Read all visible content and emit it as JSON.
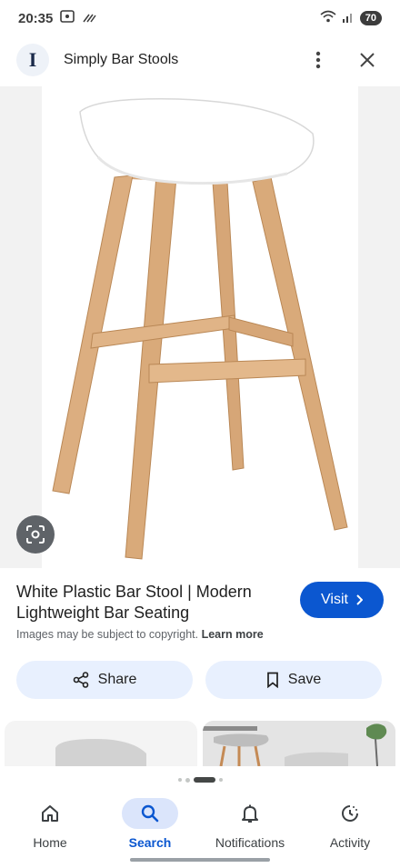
{
  "status_bar": {
    "time": "20:35",
    "battery": "70"
  },
  "header": {
    "logo_letter": "I",
    "site_name": "Simply Bar Stools"
  },
  "product": {
    "title": "White Plastic Bar Stool | Modern Lightweight Bar Seating",
    "visit_label": "Visit",
    "copyright_text": "Images may be subject to copyright.",
    "learn_more": "Learn more"
  },
  "actions": {
    "share_label": "Share",
    "save_label": "Save"
  },
  "carousel": {
    "page_count": 4,
    "active_index": 2
  },
  "nav": {
    "items": [
      {
        "label": "Home",
        "icon": "home-icon"
      },
      {
        "label": "Search",
        "icon": "search-icon",
        "active": true
      },
      {
        "label": "Notifications",
        "icon": "bell-icon"
      },
      {
        "label": "Activity",
        "icon": "activity-icon"
      }
    ]
  },
  "colors": {
    "accent": "#0b57d0",
    "chip_bg": "#e8f0fe",
    "wood": "#d8a878",
    "seat": "#ffffff"
  }
}
